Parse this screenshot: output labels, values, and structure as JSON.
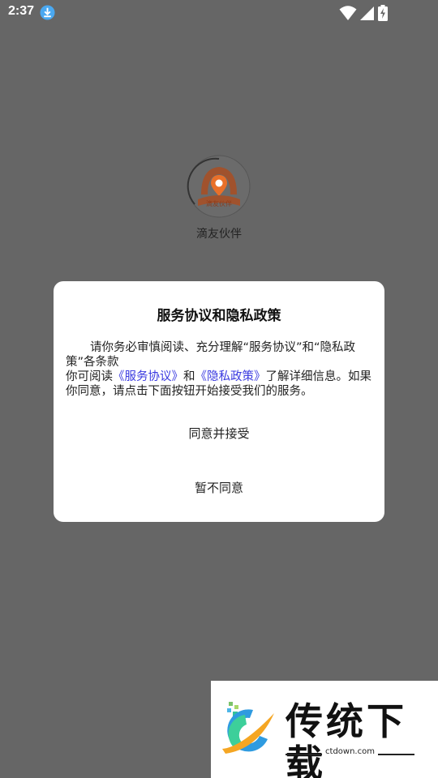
{
  "status_bar": {
    "time": "2:37",
    "download_icon": "download-icon",
    "wifi_icon": "wifi-icon",
    "signal_icon": "signal-icon",
    "battery_icon": "battery-charging-icon"
  },
  "splash": {
    "logo_icon": "app-logo-icon",
    "logo_text": "滴友伙伴",
    "app_name": "滴友伙伴"
  },
  "dialog": {
    "title": "服务协议和隐私政策",
    "body_line1": "请你务必审慎阅读、充分理解“服务协议”和“隐私政策”各条款",
    "body_prefix": "你可阅读",
    "link_service": "《服务协议》",
    "body_and": "和",
    "link_privacy": "《隐私政策》",
    "body_suffix": "了解详细信息。如果你同意，请点击下面按钮开始接受我们的服务。",
    "agree_button": "同意并接受",
    "disagree_button": "暂不同意"
  },
  "watermark": {
    "name": "传统下载",
    "domain": "ctdown.com"
  },
  "colors": {
    "overlay_background": "#666666",
    "dialog_background": "#ffffff",
    "link": "#3a3ae0",
    "logo_brown": "#a0522d",
    "logo_orange": "#e8702a"
  }
}
